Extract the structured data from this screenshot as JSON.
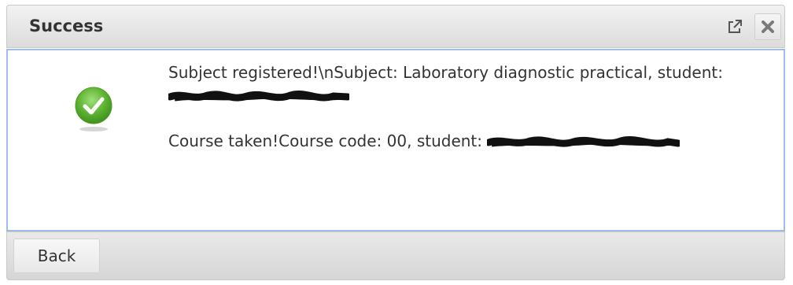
{
  "dialog": {
    "title": "Success",
    "popout_icon": "popout-icon",
    "close_icon": "close-icon",
    "status_icon": "success-check-icon",
    "accent_color": "#9dbde6",
    "success_color": "#5cb230",
    "messages": {
      "line1": "Subject registered!\\nSubject: Laboratory diagnostic practical, student: ",
      "line2": "Course taken!Course code: 00, student:"
    },
    "back_label": "Back"
  }
}
